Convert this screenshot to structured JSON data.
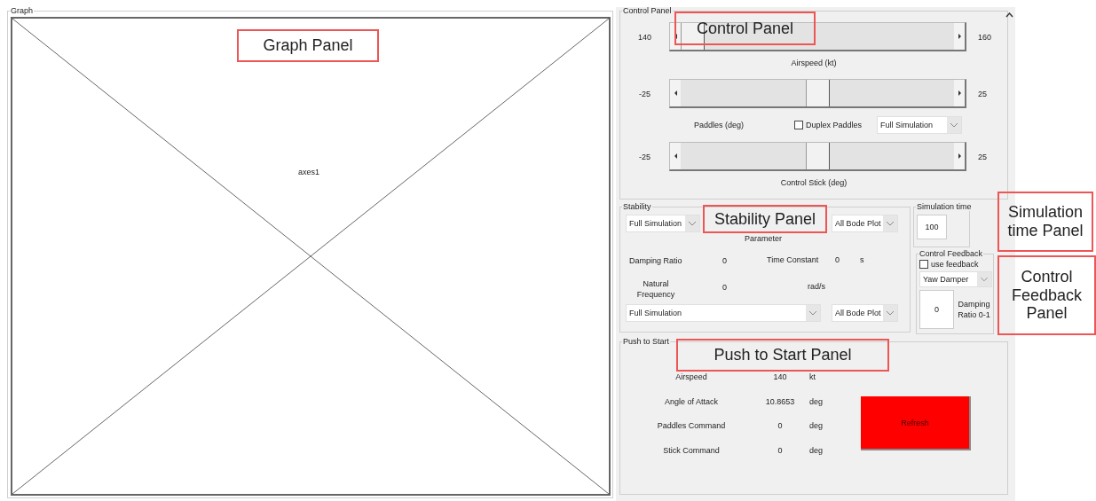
{
  "graph_panel": {
    "title": "Graph",
    "axes_label": "axes1"
  },
  "control_panel": {
    "title": "Control Panel",
    "sliders": [
      {
        "min": "140",
        "max": "160",
        "label": "Airspeed (kt)",
        "level": 0
      },
      {
        "min": "-25",
        "max": "25",
        "label": "Paddles (deg)",
        "level": 0.5
      },
      {
        "min": "-25",
        "max": "25",
        "label": "Control Stick (deg)",
        "level": 0.5
      }
    ],
    "duplex_paddles": {
      "label": "Duplex Paddles",
      "checked": false
    },
    "mode_dropdown": {
      "value": "Full Simulation"
    }
  },
  "stability_panel": {
    "title": "Stability",
    "top_dropdowns": [
      {
        "value": "Full Simulation"
      },
      {
        "value": "All Bode Plot"
      }
    ],
    "parameter_heading": "Parameter",
    "damping_ratio": {
      "label": "Damping Ratio",
      "value": "0"
    },
    "time_constant": {
      "label": "Time Constant",
      "value": "0",
      "unit": "s"
    },
    "natural_frequency": {
      "label": "Natural Frequency",
      "value": "0",
      "unit": "rad/s"
    },
    "bottom_dropdowns": [
      {
        "value": "Full Simulation"
      },
      {
        "value": "All Bode Plot"
      }
    ]
  },
  "simulation_time_panel": {
    "title": "Simulation time",
    "value": "100"
  },
  "control_feedback_panel": {
    "title": "Control Feedback",
    "use_feedback": {
      "label": "use feedback",
      "checked": false
    },
    "mode_dropdown": {
      "value": "Yaw Damper"
    },
    "value": "0",
    "value_label": "Damping Ratio 0-1"
  },
  "push_to_start_panel": {
    "title": "Push to Start",
    "readouts": [
      {
        "label": "Airspeed",
        "value": "140",
        "unit": "kt"
      },
      {
        "label": "Angle of Attack",
        "value": "10.8653",
        "unit": "deg"
      },
      {
        "label": "Paddles Command",
        "value": "0",
        "unit": "deg"
      },
      {
        "label": "Stick Command",
        "value": "0",
        "unit": "deg"
      }
    ],
    "refresh_button": {
      "label": "Refresh"
    }
  },
  "annotations": [
    {
      "text": "Graph Panel"
    },
    {
      "text": "Control Panel"
    },
    {
      "text": "Stability Panel"
    },
    {
      "text": "Simulation time Panel"
    },
    {
      "text": "Control Feedback Panel"
    },
    {
      "text": "Push to Start Panel"
    }
  ]
}
